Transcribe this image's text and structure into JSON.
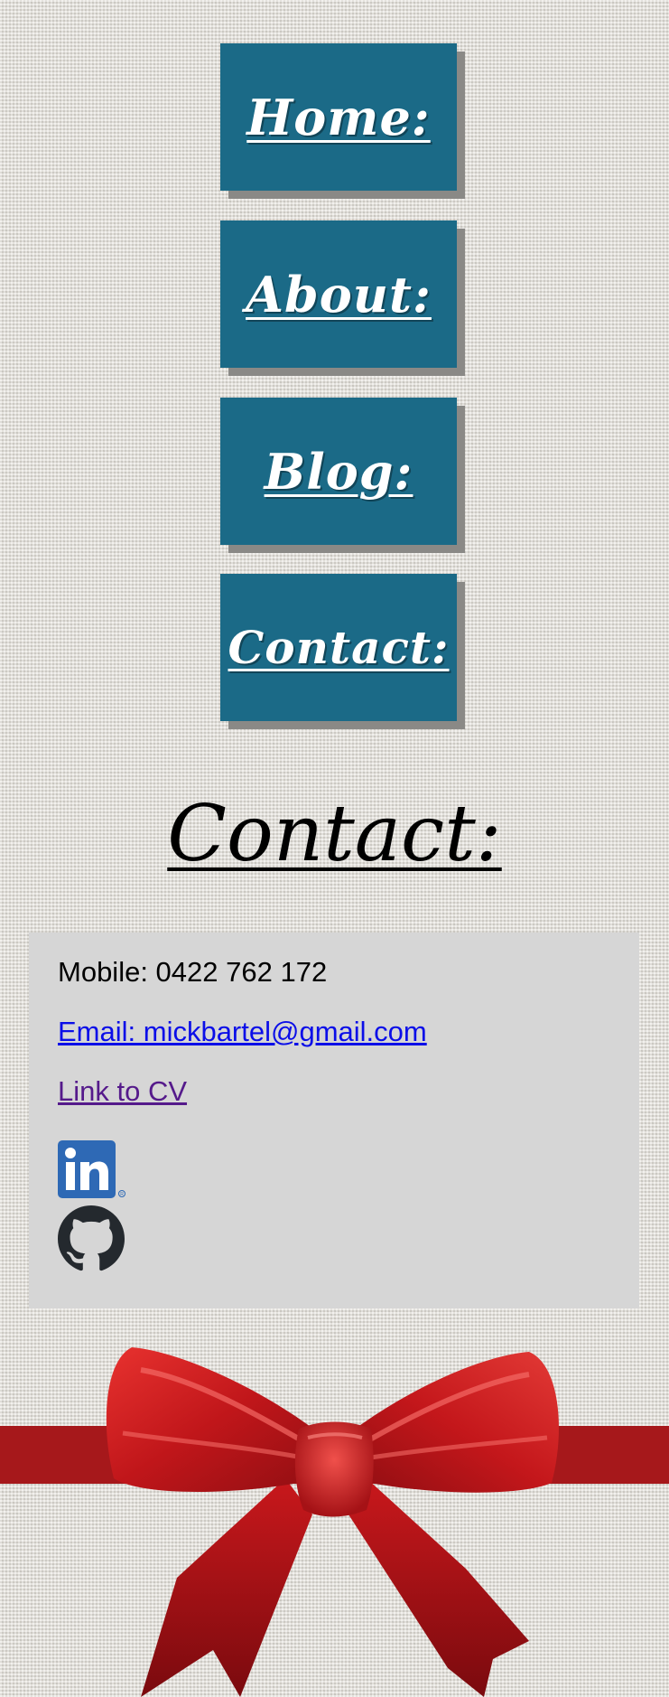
{
  "nav": {
    "items": [
      {
        "label": "Home:"
      },
      {
        "label": "About:"
      },
      {
        "label": "Blog:"
      },
      {
        "label": "Contact:"
      }
    ]
  },
  "page": {
    "title": "Contact:"
  },
  "contact": {
    "mobile": "Mobile: 0422 762 172",
    "email": "Email: mickbartel@gmail.com",
    "cv": "Link to CV",
    "linkedin_icon": "linkedin-icon",
    "github_icon": "github-icon"
  },
  "colors": {
    "nav_button": "#1b6a87",
    "nav_shadow": "#8a8986",
    "card_background": "#d6d6d6",
    "email_link": "#0b0ee8",
    "visited_link": "#551a8b",
    "ribbon": "#a6181b"
  },
  "decoration": {
    "icon": "red-ribbon-bow"
  }
}
